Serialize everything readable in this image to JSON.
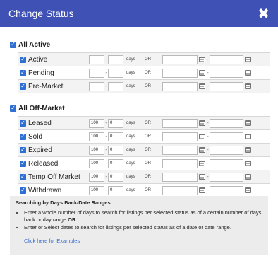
{
  "dialog": {
    "title": "Change Status",
    "close_glyph": "✖"
  },
  "groups": [
    {
      "label": "All Active",
      "checked": true,
      "rows": [
        {
          "label": "Active",
          "from": "",
          "to": "",
          "days_label": "days",
          "or_label": "OR"
        },
        {
          "label": "Pending",
          "from": "",
          "to": "",
          "days_label": "days",
          "or_label": "OR"
        },
        {
          "label": "Pre-Market",
          "from": "",
          "to": "",
          "days_label": "days",
          "or_label": "OR"
        }
      ]
    },
    {
      "label": "All Off-Market",
      "checked": true,
      "rows": [
        {
          "label": "Leased",
          "from": "100",
          "to": "0",
          "days_label": "days",
          "or_label": "OR"
        },
        {
          "label": "Sold",
          "from": "100",
          "to": "0",
          "days_label": "days",
          "or_label": "OR"
        },
        {
          "label": "Expired",
          "from": "100",
          "to": "0",
          "days_label": "days",
          "or_label": "OR"
        },
        {
          "label": "Released",
          "from": "100",
          "to": "0",
          "days_label": "days",
          "or_label": "OR"
        },
        {
          "label": "Temp Off Market",
          "from": "100",
          "to": "0",
          "days_label": "days",
          "or_label": "OR"
        },
        {
          "label": "Withdrawn",
          "from": "100",
          "to": "0",
          "days_label": "days",
          "or_label": "OR"
        }
      ]
    }
  ],
  "range_separator": "-",
  "help": {
    "title": "Searching by Days Back/Date Ranges",
    "bullet1_text": "Enter a whole number of days to search for listings per selected status as of a certain number of days back or day range ",
    "bullet1_bold": "OR",
    "bullet2": "Enter or Select dates to search for listings per selected status as of a date or date range.",
    "link": "Click here for Examples"
  },
  "colors": {
    "header_bg": "#3f51b5",
    "checkbox": "#2f6fd3",
    "link": "#3a6fd0",
    "help_bg": "#ececec"
  },
  "icons": {
    "close": "close-icon",
    "checkbox": "checkbox-checked-icon",
    "date": "calendar-icon"
  }
}
